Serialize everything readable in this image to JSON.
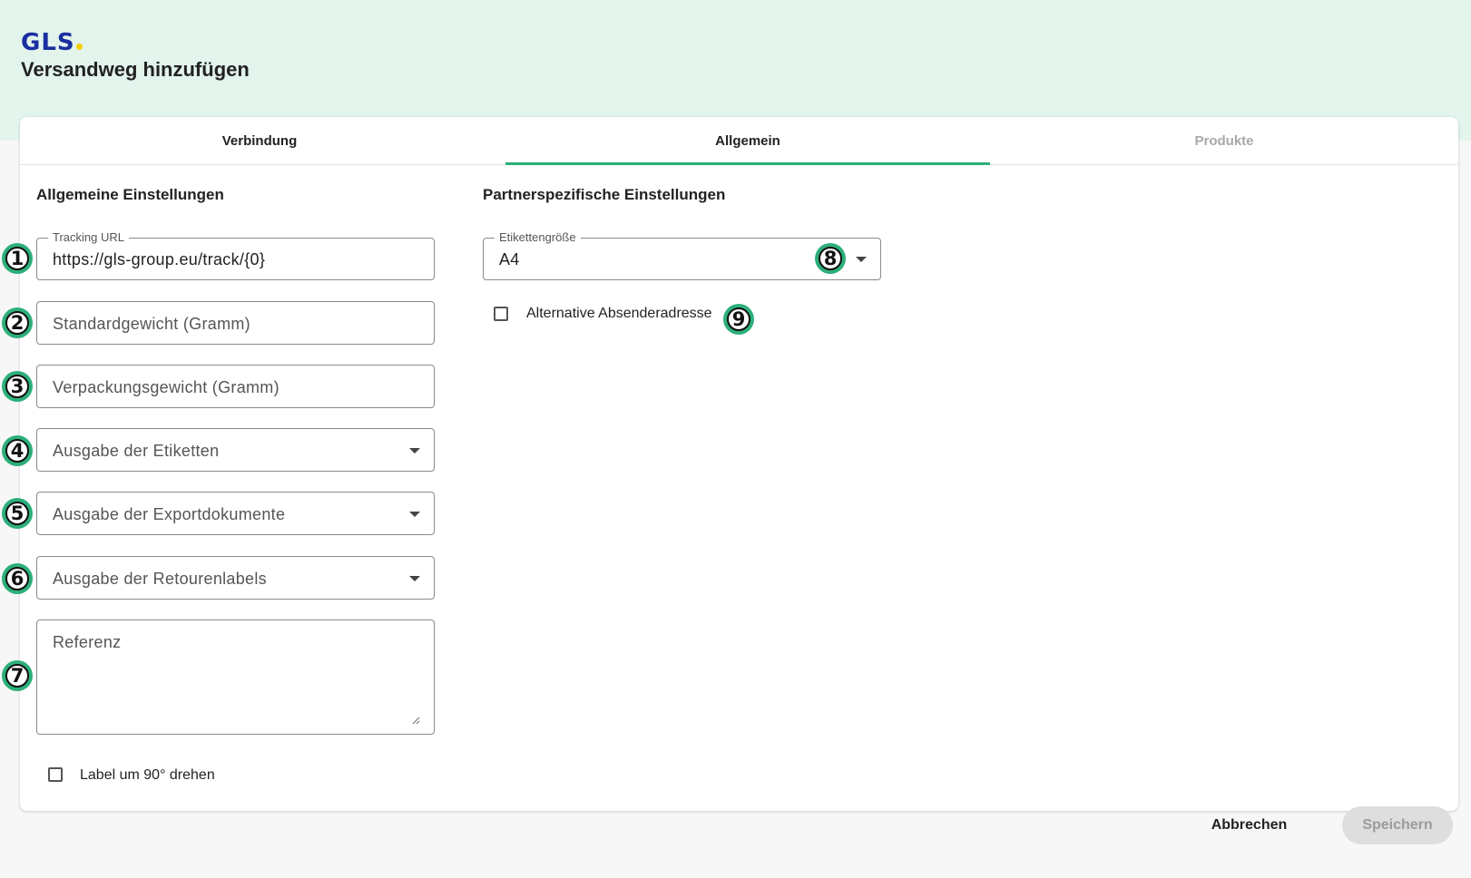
{
  "header": {
    "logo_text": "GLS",
    "title": "Versandweg hinzufügen"
  },
  "tabs": [
    {
      "label": "Verbindung",
      "state": "default"
    },
    {
      "label": "Allgemein",
      "state": "active"
    },
    {
      "label": "Produkte",
      "state": "disabled"
    }
  ],
  "general": {
    "title": "Allgemeine Einstellungen",
    "tracking_url": {
      "label": "Tracking URL",
      "value": "https://gls-group.eu/track/{0}"
    },
    "standard_weight": {
      "placeholder": "Standardgewicht (Gramm)"
    },
    "packaging_weight": {
      "placeholder": "Verpackungsgewicht (Gramm)"
    },
    "label_output": {
      "placeholder": "Ausgabe der Etiketten"
    },
    "export_docs_output": {
      "placeholder": "Ausgabe der Exportdokumente"
    },
    "return_labels_output": {
      "placeholder": "Ausgabe der Retourenlabels"
    },
    "reference": {
      "placeholder": "Referenz"
    },
    "rotate_checkbox": {
      "label": "Label um 90° drehen",
      "checked": false
    }
  },
  "partner": {
    "title": "Partnerspezifische Einstellungen",
    "label_size": {
      "label": "Etikettengröße",
      "value": "A4"
    },
    "alt_sender_checkbox": {
      "label": "Alternative Absenderadresse",
      "checked": false
    }
  },
  "annotations": [
    "1",
    "2",
    "3",
    "4",
    "5",
    "6",
    "7",
    "8",
    "9"
  ],
  "footer": {
    "cancel_label": "Abbrechen",
    "save_label": "Speichern"
  },
  "colors": {
    "accent": "#2daf7b",
    "header_bg": "#e2f4ec",
    "logo_blue": "#1a2ea1",
    "logo_yellow": "#f5cc00"
  }
}
